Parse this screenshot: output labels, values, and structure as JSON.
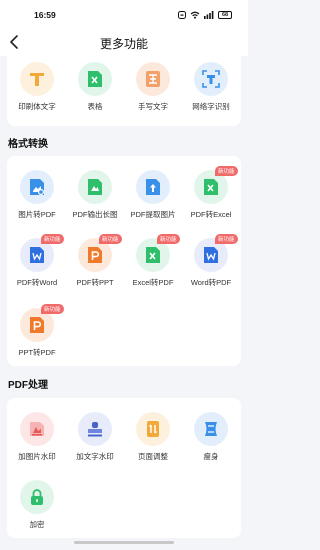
{
  "status_bar": {
    "time": "16:59",
    "battery": "68"
  },
  "header": {
    "title": "更多功能"
  },
  "top_tools": [
    {
      "label": "印刷体文字",
      "icon": "letter-t-icon"
    },
    {
      "label": "表格",
      "icon": "excel-icon"
    },
    {
      "label": "手写文字",
      "icon": "handwriting-icon"
    },
    {
      "label": "网络字识别",
      "icon": "scan-text-icon"
    }
  ],
  "format_section": {
    "title": "格式转换",
    "items": [
      {
        "label": "图片转PDF",
        "icon": "image-to-pdf-icon",
        "badge": ""
      },
      {
        "label": "PDF输出长图",
        "icon": "pdf-long-image-icon",
        "badge": ""
      },
      {
        "label": "PDF提取图片",
        "icon": "pdf-extract-image-icon",
        "badge": ""
      },
      {
        "label": "PDF转Excel",
        "icon": "excel-icon",
        "badge": "新功能"
      },
      {
        "label": "PDF转Word",
        "icon": "word-icon",
        "badge": "新功能"
      },
      {
        "label": "PDF转PPT",
        "icon": "ppt-icon",
        "badge": "新功能"
      },
      {
        "label": "Excel转PDF",
        "icon": "excel-icon",
        "badge": "新功能"
      },
      {
        "label": "Word转PDF",
        "icon": "word-icon",
        "badge": "新功能"
      },
      {
        "label": "PPT转PDF",
        "icon": "ppt-icon",
        "badge": "新功能"
      }
    ]
  },
  "pdf_section": {
    "title": "PDF处理",
    "items": [
      {
        "label": "加图片水印",
        "icon": "image-watermark-icon"
      },
      {
        "label": "加文字水印",
        "icon": "text-watermark-icon"
      },
      {
        "label": "页面调整",
        "icon": "page-adjust-icon"
      },
      {
        "label": "瘦身",
        "icon": "compress-icon"
      },
      {
        "label": "加密",
        "icon": "lock-icon"
      }
    ]
  },
  "colors": {
    "background": "#f3f5f8",
    "badge": "#f06a6a",
    "green": "#2fbf6c",
    "blue": "#2f6fe0",
    "orange": "#f07a2c",
    "yellow": "#f3a93a"
  }
}
